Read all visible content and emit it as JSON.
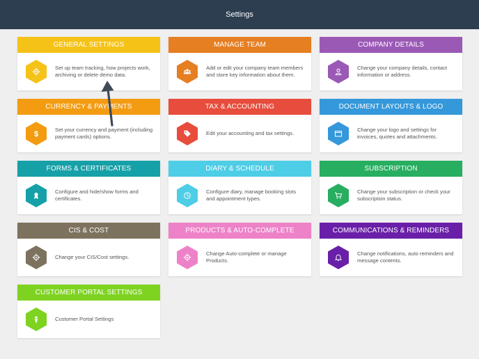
{
  "header": {
    "title": "Settings"
  },
  "colors": {
    "general": "#f5c218",
    "manage": "#e67e22",
    "company": "#9b59b6",
    "currency": "#f39c12",
    "tax": "#e74c3c",
    "document": "#3498db",
    "forms": "#16a0a8",
    "diary": "#4ecde6",
    "subscription": "#27ae60",
    "cis": "#7d725e",
    "products": "#ee82c8",
    "communications": "#6a1fa8",
    "portal": "#7ed321"
  },
  "cards": [
    {
      "title": "GENERAL SETTINGS",
      "desc": "Set up team tracking, how projects work, archiving or delete demo data.",
      "icon": "gear-icon"
    },
    {
      "title": "MANAGE TEAM",
      "desc": "Add or edit your company team members and store key information about them.",
      "icon": "team-icon"
    },
    {
      "title": "COMPANY DETAILS",
      "desc": "Change your company details, contact information or address.",
      "icon": "user-icon"
    },
    {
      "title": "CURRENCY & PAYMENTS",
      "desc": "Set your currency and payment (including payment cards) options.",
      "icon": "dollar-icon"
    },
    {
      "title": "TAX & ACCOUNTING",
      "desc": "Edit your accounting and tax settings.",
      "icon": "tag-icon"
    },
    {
      "title": "DOCUMENT LAYOUTS & LOGO",
      "desc": "Change your logo and settings for invoices, quotes and attachments.",
      "icon": "folder-icon"
    },
    {
      "title": "FORMS & CERTIFICATES",
      "desc": "Configure and hide/show forms and certificates.",
      "icon": "certificate-icon"
    },
    {
      "title": "DIARY & SCHEDULE",
      "desc": "Configure diary, manage booking slots and appointment types.",
      "icon": "clock-icon"
    },
    {
      "title": "SUBSCRIPTION",
      "desc": "Change your subscription or check your subscription status.",
      "icon": "cart-icon"
    },
    {
      "title": "CIS & COST",
      "desc": "Change your CIS/Cost settings.",
      "icon": "gear-icon"
    },
    {
      "title": "PRODUCTS & AUTO-COMPLETE",
      "desc": "Change Auto-complete or manage Products.",
      "icon": "gear-icon"
    },
    {
      "title": "COMMUNICATIONS & REMINDERS",
      "desc": "Change notifications, auto reminders and message contents.",
      "icon": "bell-icon"
    },
    {
      "title": "CUSTOMER PORTAL SETTINGS",
      "desc": "Customer Portal Settings",
      "icon": "person-icon"
    }
  ]
}
